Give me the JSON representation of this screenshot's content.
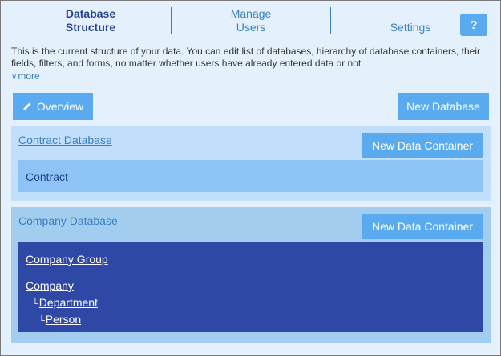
{
  "tabs": {
    "database_structure_line1": "Database",
    "database_structure_line2": "Structure",
    "manage_users_line1": "Manage",
    "manage_users_line2": "Users",
    "settings": "Settings"
  },
  "help_label": "?",
  "description": "This is the current structure of your data. You can edit list of databases, hierarchy of database containers, their fields, filters, and forms, no matter whether users have already entered data or not.",
  "more_label": "more",
  "toolbar": {
    "overview_label": "Overview",
    "new_database_label": "New Database"
  },
  "databases": [
    {
      "title": "Contract Database",
      "new_container_label": "New Data Container",
      "containers": [
        {
          "label": "Contract"
        }
      ]
    },
    {
      "title": "Company Database",
      "new_container_label": "New Data Container",
      "containers": [
        {
          "label": "Company Group"
        },
        {
          "label": "Company"
        },
        {
          "label": "Department"
        },
        {
          "label": "Person"
        }
      ]
    }
  ],
  "colors": {
    "accent": "#5aaaf0",
    "active_tab": "#24428e",
    "link": "#3a7fc0",
    "selected_tree": "#2f48a6",
    "background": "#e4f0fc"
  },
  "icons": {
    "overview": "pencil-icon",
    "more": "chevron-down-icon",
    "tree_branch": "tree-branch-icon"
  }
}
